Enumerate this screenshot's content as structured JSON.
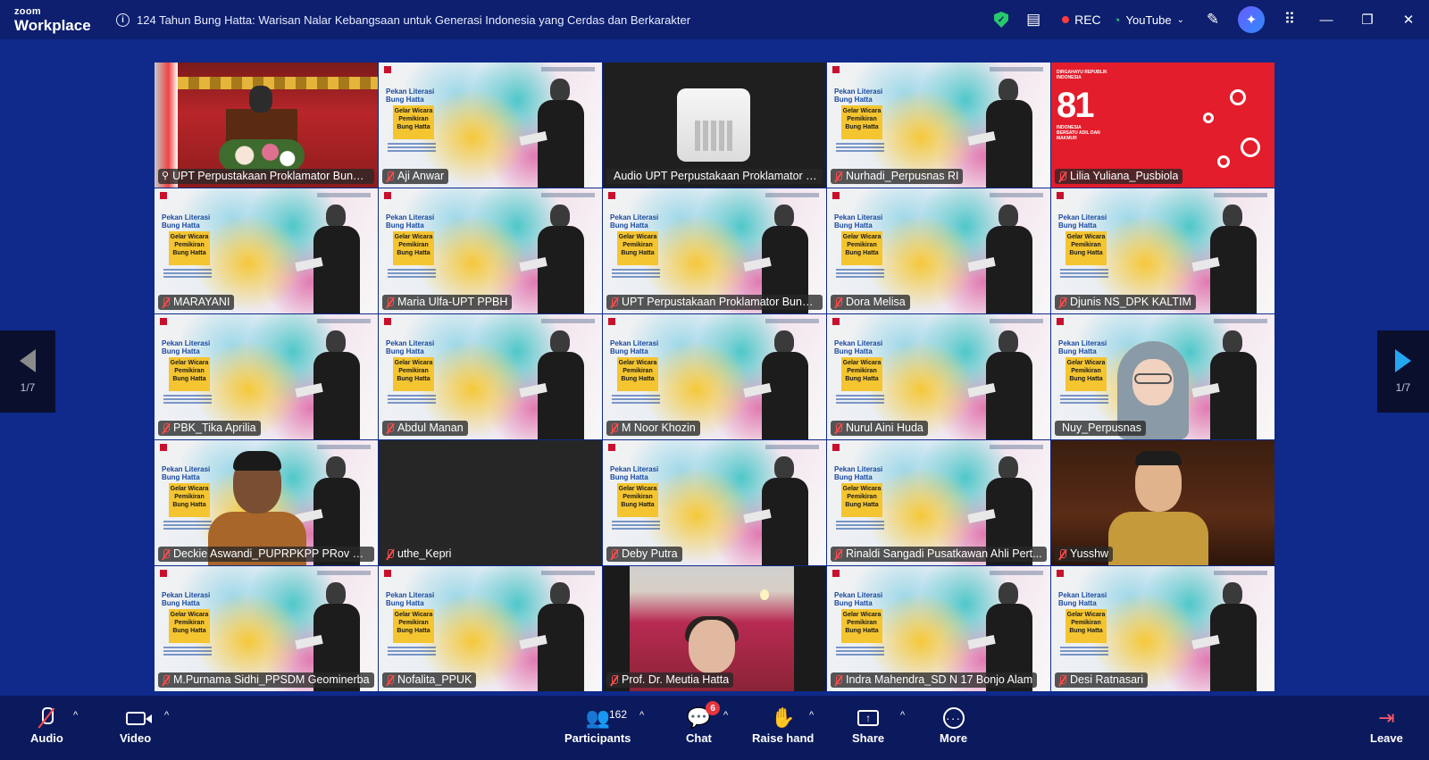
{
  "app": {
    "brand_top": "zoom",
    "brand_bottom": "Workplace",
    "meeting_title": "124 Tahun Bung Hatta: Warisan Nalar Kebangsaan untuk Generasi Indonesia yang Cerdas dan Berkarakter",
    "rec_label": "REC",
    "stream_label": "YouTube"
  },
  "poster": {
    "title_line1": "Pekan Literasi",
    "title_line2": "Bung Hatta",
    "box_text": "Gelar Wicara Pemikiran Bung Hatta"
  },
  "red_tile": {
    "small": "DIRGAHAYU REPUBLIK INDONESIA",
    "big": "81",
    "sub": "INDONESIA BERSATU ADIL DAN MAKMUR"
  },
  "participants": [
    {
      "name": "UPT Perpustakaan Proklamator Bung ...",
      "kind": "stage",
      "muted": false,
      "active": true
    },
    {
      "name": "Aji Anwar",
      "kind": "poster",
      "muted": true
    },
    {
      "name": "Audio UPT Perpustakaan Proklamator Bu...",
      "kind": "audio",
      "muted": false
    },
    {
      "name": "Nurhadi_Perpusnas RI",
      "kind": "poster",
      "muted": true
    },
    {
      "name": "Lilia Yuliana_Pusbiola",
      "kind": "red",
      "muted": true
    },
    {
      "name": "MARAYANI",
      "kind": "poster",
      "muted": true
    },
    {
      "name": "Maria Ulfa-UPT PPBH",
      "kind": "poster",
      "muted": true
    },
    {
      "name": "UPT Perpustakaan Proklamator Bung ...",
      "kind": "poster",
      "muted": true
    },
    {
      "name": "Dora Melisa",
      "kind": "poster",
      "muted": true
    },
    {
      "name": "Djunis NS_DPK KALTIM",
      "kind": "poster",
      "muted": true
    },
    {
      "name": "PBK_Tika Aprilia",
      "kind": "poster",
      "muted": true
    },
    {
      "name": "Abdul Manan",
      "kind": "poster",
      "muted": true
    },
    {
      "name": "M Noor Khozin",
      "kind": "poster",
      "muted": true
    },
    {
      "name": "Nurul Aini Huda",
      "kind": "poster",
      "muted": true
    },
    {
      "name": "Nuy_Perpusnas",
      "kind": "hijab",
      "muted": false
    },
    {
      "name": "Deckie Aswandi_PUPRPKPP PRov Riau",
      "kind": "man",
      "muted": true
    },
    {
      "name": "uthe_Kepri",
      "kind": "dark",
      "muted": true
    },
    {
      "name": "Deby Putra",
      "kind": "poster",
      "muted": true
    },
    {
      "name": "Rinaldi Sangadi Pusatkawan Ahli Pert...",
      "kind": "poster",
      "muted": true
    },
    {
      "name": "Yusshw",
      "kind": "room",
      "muted": true
    },
    {
      "name": "M.Purnama Sidhi_PPSDM Geominerba",
      "kind": "poster",
      "muted": true
    },
    {
      "name": "Nofalita_PPUK",
      "kind": "poster",
      "muted": true
    },
    {
      "name": "Prof. Dr. Meutia Hatta",
      "kind": "meutia",
      "muted": true
    },
    {
      "name": "Indra Mahendra_SD N 17 Bonjo Alam",
      "kind": "poster",
      "muted": true
    },
    {
      "name": "Desi Ratnasari",
      "kind": "poster",
      "muted": true
    }
  ],
  "pager": {
    "left": "1/7",
    "right": "1/7"
  },
  "toolbar": {
    "audio": "Audio",
    "video": "Video",
    "participants": "Participants",
    "participants_count": "162",
    "chat": "Chat",
    "chat_badge": "6",
    "raise_hand": "Raise hand",
    "share": "Share",
    "more": "More",
    "leave": "Leave"
  }
}
